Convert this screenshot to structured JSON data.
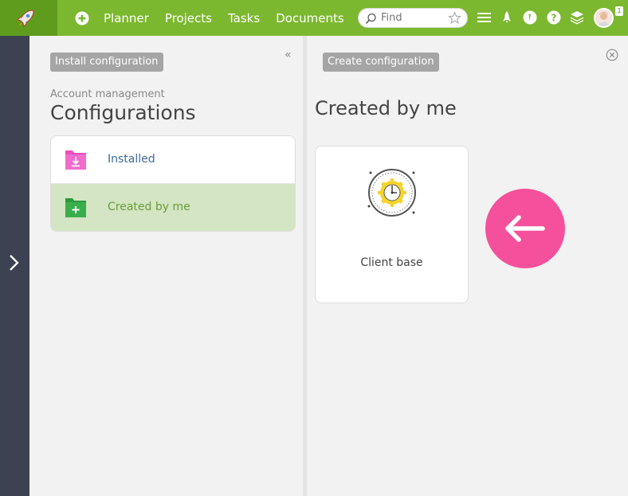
{
  "topbar": {
    "logo_icon": "rocket-icon",
    "nav": [
      "Planner",
      "Projects",
      "Tasks",
      "Documents"
    ],
    "search_placeholder": "Find",
    "avatar_badge": "1",
    "icons": [
      "menu-icon",
      "rocket-icon",
      "timer-icon",
      "help-icon",
      "layers-icon"
    ]
  },
  "left": {
    "install_button": "Install configuration",
    "breadcrumb": "Account management",
    "title": "Configurations",
    "items": [
      {
        "label": "Installed",
        "icon": "download-folder-icon",
        "color": "#ee4fbd"
      },
      {
        "label": "Created by me",
        "icon": "add-folder-icon",
        "color": "#3aae4d"
      }
    ]
  },
  "right": {
    "create_button": "Create configuration",
    "title": "Created by me",
    "cards": [
      {
        "label": "Client base",
        "icon": "gear-clock-icon"
      }
    ]
  },
  "colors": {
    "topbar": "#7cb82f",
    "rail": "#3d4253",
    "selected_row": "#d3e5c2",
    "arrow_circle": "#f4509b"
  }
}
